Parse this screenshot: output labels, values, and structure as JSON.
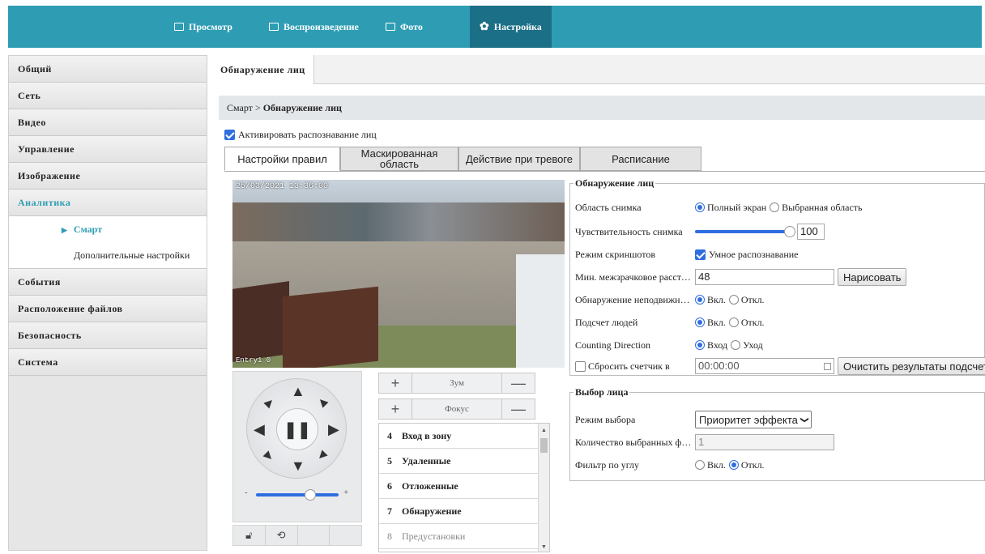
{
  "topnav": {
    "items": [
      {
        "label": "Просмотр",
        "icon": "monitor-icon"
      },
      {
        "label": "Воспроизведение",
        "icon": "film-icon"
      },
      {
        "label": "Фото",
        "icon": "image-icon"
      },
      {
        "label": "Настройка",
        "icon": "gear-icon",
        "active": true
      }
    ]
  },
  "sidebar": {
    "items": [
      "Общий",
      "Сеть",
      "Видео",
      "Управление",
      "Изображение",
      "Аналитика",
      "События",
      "Расположение файлов",
      "Безопасность",
      "Система"
    ],
    "active_index": 5,
    "sub": {
      "active": "Смарт",
      "other": "Дополнительные настройки"
    }
  },
  "main": {
    "tab": "Обнаружение лиц",
    "breadcrumb": {
      "parent": "Смарт",
      "sep": ">",
      "current": "Обнаружение лиц"
    },
    "activate_label": "Активировать распознавание лиц",
    "rule_tabs": [
      "Настройки правил",
      "Маскированная область",
      "Действие при тревоге",
      "Расписание"
    ]
  },
  "video": {
    "timestamp": "25/03/2021 13:36:00",
    "camera": "Entry1  0"
  },
  "ptz": {
    "zoom_label": "Зум",
    "focus_label": "Фокус",
    "plus": "+",
    "minus": "—",
    "slider_min": "-",
    "slider_max": "+"
  },
  "presets": [
    {
      "num": "4",
      "name": "Вход в зону"
    },
    {
      "num": "5",
      "name": "Удаленные"
    },
    {
      "num": "6",
      "name": "Отложенные"
    },
    {
      "num": "7",
      "name": "Обнаружение"
    },
    {
      "num": "8",
      "name": "Предустановки",
      "dim": true
    }
  ],
  "detection": {
    "legend": "Обнаружение лиц",
    "area_label": "Область снимка",
    "area_opts": [
      "Полный экран",
      "Выбранная область"
    ],
    "sens_label": "Чувствительность снимка",
    "sens_value": "100",
    "mode_label": "Режим скриншотов",
    "mode_opt": "Умное распознавание",
    "dist_label": "Мин. межзрачковое расстояние",
    "dist_value": "48",
    "draw_button": "Нарисовать",
    "static_label": "Обнаружение неподвижных лиц",
    "on": "Вкл.",
    "off": "Откл.",
    "count_label": "Подсчет людей",
    "dir_label": "Counting Direction",
    "dir_opts": [
      "Вход",
      "Уход"
    ],
    "reset_label": "Сбросить счетчик в",
    "reset_time": "00:00:00",
    "clear_button": "Очистить результаты подсчета"
  },
  "selection": {
    "legend": "Выбор лица",
    "mode_label": "Режим выбора",
    "mode_value": "Приоритет эффекта",
    "count_label": "Количество выбранных фото",
    "count_value": "1",
    "angle_label": "Фильтр по углу"
  }
}
